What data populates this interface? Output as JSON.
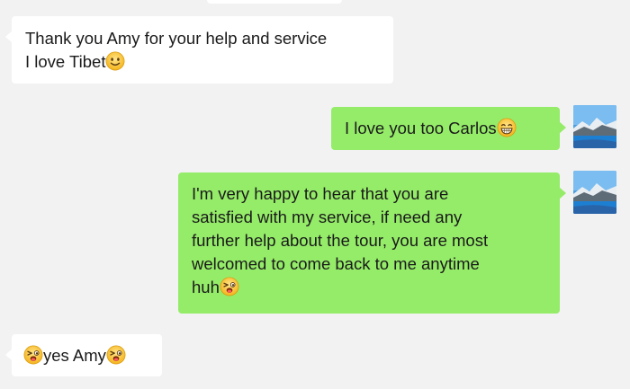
{
  "messages": [
    {
      "direction": "incoming",
      "lines": [
        "Thank you Amy for your help and service",
        "I love Tibet"
      ],
      "emoji": "smile-emoji"
    },
    {
      "direction": "outgoing",
      "text": "I love you too Carlos",
      "emoji": "grin-emoji",
      "avatar": "landscape-avatar"
    },
    {
      "direction": "outgoing",
      "lines": [
        "I'm very happy to hear that you are",
        "satisfied with my service, if need any",
        "further help about the tour, you are most",
        "welcomed to come back to me anytime",
        "huh"
      ],
      "emoji": "wink-tongue-emoji",
      "avatar": "landscape-avatar"
    },
    {
      "direction": "incoming",
      "text": "yes Amy",
      "emoji": "wink-tongue-emoji"
    }
  ],
  "colors": {
    "background": "#f2f2f2",
    "incoming_bubble": "#ffffff",
    "outgoing_bubble": "#95ec69",
    "text": "#1a1a1a"
  }
}
